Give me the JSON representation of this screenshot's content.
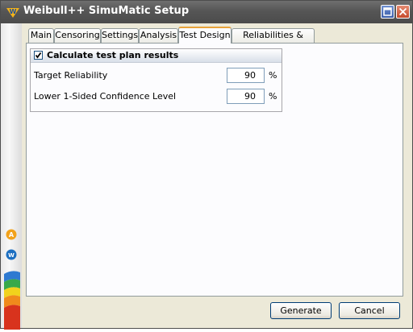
{
  "window": {
    "title": "Weibull++ SimuMatic Setup"
  },
  "tabs": [
    {
      "label": "Main",
      "active": false
    },
    {
      "label": "Censoring",
      "active": false
    },
    {
      "label": "Settings",
      "active": false
    },
    {
      "label": "Analysis",
      "active": false
    },
    {
      "label": "Test Design",
      "active": true
    },
    {
      "label": "Reliabilities & Times",
      "active": false
    }
  ],
  "test_plan": {
    "checkbox_checked": true,
    "title": "Calculate test plan results",
    "target_reliability": {
      "label": "Target Reliability",
      "value": "90",
      "unit": "%"
    },
    "confidence_level": {
      "label": "Lower 1-Sided Confidence Level",
      "value": "90",
      "unit": "%"
    }
  },
  "buttons": {
    "generate": "Generate",
    "cancel": "Cancel"
  },
  "icons": [
    "weibull-logo-icon",
    "maximize-icon",
    "close-icon",
    "alta-app-icon",
    "weibull-app-icon"
  ],
  "colors": {
    "titlebar": "#565656",
    "active_tab_accent": "#e9a33a",
    "close_button": "#c54a2b"
  }
}
